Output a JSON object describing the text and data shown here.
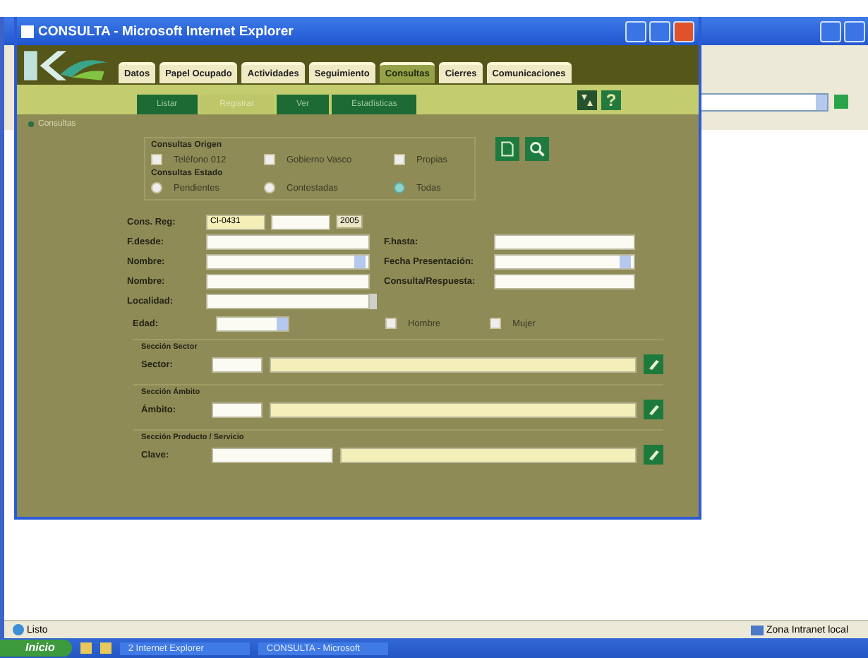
{
  "window": {
    "title": "CONSULTA - Microsoft Internet Explorer"
  },
  "tabs": [
    {
      "label": "Datos",
      "selected": false
    },
    {
      "label": "Papel Ocupado",
      "selected": false
    },
    {
      "label": "Actividades",
      "selected": false
    },
    {
      "label": "Seguimiento",
      "selected": false
    },
    {
      "label": "Consultas",
      "selected": true
    },
    {
      "label": "Cierres",
      "selected": false
    },
    {
      "label": "Comunicaciones",
      "selected": false
    }
  ],
  "subtabs": [
    {
      "label": "Listar",
      "selected": false
    },
    {
      "label": "Registrar",
      "selected": true
    },
    {
      "label": "Ver",
      "selected": false
    },
    {
      "label": "Estadísticas",
      "selected": false
    }
  ],
  "help_button": "?",
  "breadcrumb": "Consultas",
  "origin_group": {
    "title": "Consultas Origen",
    "options": [
      {
        "label": "Teléfono 012",
        "checked": false
      },
      {
        "label": "Gobierno Vasco",
        "checked": false
      },
      {
        "label": "Propias",
        "checked": false
      }
    ]
  },
  "state_group": {
    "title": "Consultas Estado",
    "options": [
      {
        "label": "Pendientes",
        "selected": false
      },
      {
        "label": "Contestadas",
        "selected": false
      },
      {
        "label": "Todas",
        "selected": true
      }
    ]
  },
  "register": {
    "label": "Cons. Reg:",
    "value": "CI-0431",
    "button": "2005"
  },
  "form_rows": [
    [
      {
        "label": "F.desde:",
        "kind": "text"
      },
      {
        "label": "F.hasta:",
        "kind": "text"
      }
    ],
    [
      {
        "label": "Nombre:",
        "kind": "select"
      },
      {
        "label": "Fecha Presentación:",
        "kind": "select"
      }
    ],
    [
      {
        "label": "Nombre:",
        "kind": "text"
      },
      {
        "label": "Consulta/Respuesta:",
        "kind": "text"
      }
    ],
    [
      {
        "label": "Localidad:",
        "kind": "combo"
      }
    ]
  ],
  "age": {
    "label": "Edad:",
    "options": [
      {
        "label": "Hombre",
        "checked": false
      },
      {
        "label": "Mujer",
        "checked": false
      }
    ]
  },
  "sections": [
    {
      "title": "Sección Sector",
      "label": "Sector:"
    },
    {
      "title": "Sección Ámbito",
      "label": "Ámbito:"
    },
    {
      "title": "Sección Producto / Servicio",
      "label": "Clave:"
    }
  ],
  "status_bar": {
    "text": "Listo",
    "zone": "Zona Intranet local"
  },
  "taskbar": {
    "start": "Inicio",
    "tasks": [
      "2 Internet Explorer",
      "CONSULTA - Microsoft"
    ]
  }
}
